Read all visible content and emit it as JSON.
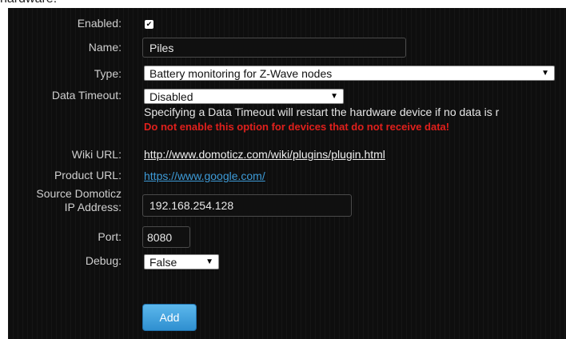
{
  "page": {
    "heading_fragment": "hardware:"
  },
  "form": {
    "enabled": {
      "label": "Enabled:",
      "checked": true,
      "checkmark": "✔"
    },
    "name": {
      "label": "Name:",
      "value": "Piles"
    },
    "type": {
      "label": "Type:",
      "selected": "Battery monitoring for Z-Wave nodes"
    },
    "data_timeout": {
      "label": "Data Timeout:",
      "selected": "Disabled",
      "help": "Specifying a Data Timeout will restart the hardware device if no data is r",
      "warning": "Do not enable this option for devices that do not receive data!"
    },
    "wiki_url": {
      "label": "Wiki URL:",
      "value": "http://www.domoticz.com/wiki/plugins/plugin.html"
    },
    "product_url": {
      "label": "Product URL:",
      "value": "https://www.google.com/"
    },
    "source_ip": {
      "label_line1": "Source Domoticz",
      "label_line2": "IP Address:",
      "value": "192.168.254.128"
    },
    "port": {
      "label": "Port:",
      "value": "8080"
    },
    "debug": {
      "label": "Debug:",
      "selected": "False"
    },
    "add_button": "Add"
  },
  "icons": {
    "dropdown": "dropdown-arrow-icon",
    "check": "check-icon"
  }
}
